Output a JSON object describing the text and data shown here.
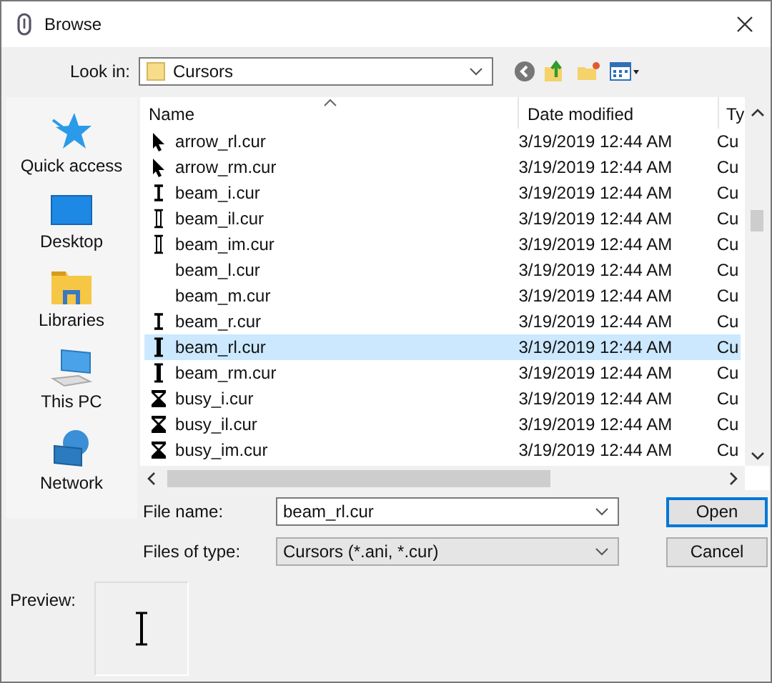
{
  "window": {
    "title": "Browse"
  },
  "look_in": {
    "label": "Look in:",
    "value": "Cursors"
  },
  "sidebar": {
    "items": [
      {
        "label": "Quick access",
        "kind": "star"
      },
      {
        "label": "Desktop",
        "kind": "desktop"
      },
      {
        "label": "Libraries",
        "kind": "library"
      },
      {
        "label": "This PC",
        "kind": "computer"
      },
      {
        "label": "Network",
        "kind": "network"
      }
    ]
  },
  "file_list": {
    "columns": [
      "Name",
      "Date modified",
      "Ty"
    ],
    "rows": [
      {
        "name": "arrow_rl.cur",
        "date": "3/19/2019 12:44 AM",
        "type": "Cu",
        "kind": "arrow",
        "selected": false
      },
      {
        "name": "arrow_rm.cur",
        "date": "3/19/2019 12:44 AM",
        "type": "Cu",
        "kind": "arrow",
        "selected": false
      },
      {
        "name": "beam_i.cur",
        "date": "3/19/2019 12:44 AM",
        "type": "Cu",
        "kind": "beam",
        "selected": false
      },
      {
        "name": "beam_il.cur",
        "date": "3/19/2019 12:44 AM",
        "type": "Cu",
        "kind": "hollowbeam",
        "selected": false
      },
      {
        "name": "beam_im.cur",
        "date": "3/19/2019 12:44 AM",
        "type": "Cu",
        "kind": "hollowbeam",
        "selected": false
      },
      {
        "name": "beam_l.cur",
        "date": "3/19/2019 12:44 AM",
        "type": "Cu",
        "kind": "blank",
        "selected": false
      },
      {
        "name": "beam_m.cur",
        "date": "3/19/2019 12:44 AM",
        "type": "Cu",
        "kind": "blank",
        "selected": false
      },
      {
        "name": "beam_r.cur",
        "date": "3/19/2019 12:44 AM",
        "type": "Cu",
        "kind": "beam",
        "selected": false
      },
      {
        "name": "beam_rl.cur",
        "date": "3/19/2019 12:44 AM",
        "type": "Cu",
        "kind": "boldbeam",
        "selected": true
      },
      {
        "name": "beam_rm.cur",
        "date": "3/19/2019 12:44 AM",
        "type": "Cu",
        "kind": "boldbeam",
        "selected": false
      },
      {
        "name": "busy_i.cur",
        "date": "3/19/2019 12:44 AM",
        "type": "Cu",
        "kind": "hourglass",
        "selected": false
      },
      {
        "name": "busy_il.cur",
        "date": "3/19/2019 12:44 AM",
        "type": "Cu",
        "kind": "hourglass",
        "selected": false
      },
      {
        "name": "busy_im.cur",
        "date": "3/19/2019 12:44 AM",
        "type": "Cu",
        "kind": "hourglass",
        "selected": false
      }
    ]
  },
  "file_name": {
    "label": "File name:",
    "value": "beam_rl.cur"
  },
  "files_of_type": {
    "label": "Files of type:",
    "value": "Cursors (*.ani, *.cur)"
  },
  "buttons": [
    {
      "label": "Open",
      "focused": true
    },
    {
      "label": "Cancel",
      "focused": false
    }
  ],
  "preview": {
    "label": "Preview:"
  }
}
